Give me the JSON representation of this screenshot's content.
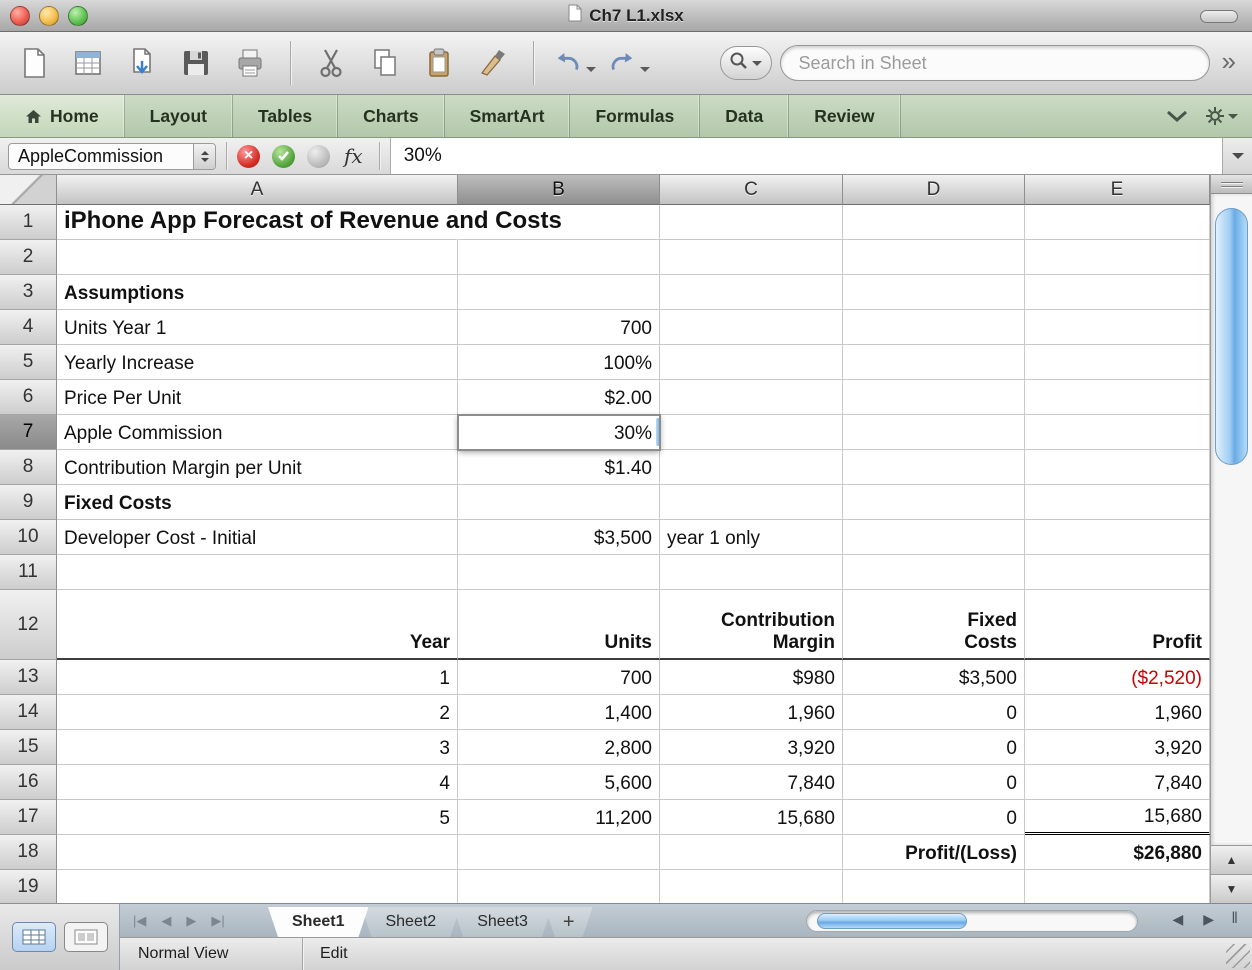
{
  "window": {
    "title": "Ch7 L1.xlsx"
  },
  "toolbar": {
    "groups": [
      [
        "new-document",
        "template-gallery",
        "import",
        "save",
        "print"
      ],
      [
        "cut",
        "copy",
        "paste",
        "format-painter"
      ],
      [
        "undo",
        "redo"
      ]
    ],
    "search_placeholder": "Search in Sheet",
    "overflow_label": "»"
  },
  "ribbon": {
    "tabs": [
      {
        "label": "Home",
        "icon": "home",
        "active": true
      },
      {
        "label": "Layout"
      },
      {
        "label": "Tables"
      },
      {
        "label": "Charts"
      },
      {
        "label": "SmartArt"
      },
      {
        "label": "Formulas"
      },
      {
        "label": "Data"
      },
      {
        "label": "Review"
      }
    ]
  },
  "formula_bar": {
    "name_box": "AppleCommission",
    "cancel_label": "×",
    "fx": "fx",
    "value": "30%"
  },
  "grid": {
    "column_headers": [
      "A",
      "B",
      "C",
      "D",
      "E"
    ],
    "selected_column": "B",
    "selected_row": 7,
    "rows": [
      {
        "n": 1,
        "cells": {
          "A": {
            "v": "iPhone App Forecast of Revenue and Costs",
            "bold": true,
            "size": "title",
            "spill": true
          }
        }
      },
      {
        "n": 2,
        "cells": {}
      },
      {
        "n": 3,
        "cells": {
          "A": {
            "v": "Assumptions",
            "bold": true
          }
        }
      },
      {
        "n": 4,
        "cells": {
          "A": {
            "v": "Units Year 1"
          },
          "B": {
            "v": "700",
            "align": "right"
          }
        }
      },
      {
        "n": 5,
        "cells": {
          "A": {
            "v": "Yearly Increase"
          },
          "B": {
            "v": "100%",
            "align": "right"
          }
        }
      },
      {
        "n": 6,
        "cells": {
          "A": {
            "v": "Price Per Unit"
          },
          "B": {
            "v": "$2.00",
            "align": "right"
          }
        }
      },
      {
        "n": 7,
        "cells": {
          "A": {
            "v": "Apple Commission"
          },
          "B": {
            "v": "30%",
            "align": "right",
            "selected": true
          }
        }
      },
      {
        "n": 8,
        "cells": {
          "A": {
            "v": "Contribution Margin per Unit"
          },
          "B": {
            "v": "$1.40",
            "align": "right"
          }
        }
      },
      {
        "n": 9,
        "cells": {
          "A": {
            "v": "Fixed  Costs",
            "bold": true
          }
        }
      },
      {
        "n": 10,
        "cells": {
          "A": {
            "v": "Developer Cost - Initial"
          },
          "B": {
            "v": "$3,500",
            "align": "right"
          },
          "C": {
            "v": "year 1 only"
          }
        }
      },
      {
        "n": 11,
        "cells": {}
      },
      {
        "n": 12,
        "tall": true,
        "border_bottom": true,
        "cells": {
          "A": {
            "v": "Year",
            "bold": true,
            "align": "right"
          },
          "B": {
            "v": "Units",
            "bold": true,
            "align": "right"
          },
          "C": {
            "v": "Contribution\nMargin",
            "bold": true,
            "align": "right"
          },
          "D": {
            "v": "Fixed\nCosts",
            "bold": true,
            "align": "right"
          },
          "E": {
            "v": "Profit",
            "bold": true,
            "align": "right"
          }
        }
      },
      {
        "n": 13,
        "cells": {
          "A": {
            "v": "1",
            "align": "right"
          },
          "B": {
            "v": "700",
            "align": "right"
          },
          "C": {
            "v": "$980",
            "align": "right"
          },
          "D": {
            "v": "$3,500",
            "align": "right"
          },
          "E": {
            "v": "($2,520)",
            "align": "right",
            "color": "negative"
          }
        }
      },
      {
        "n": 14,
        "cells": {
          "A": {
            "v": "2",
            "align": "right"
          },
          "B": {
            "v": "1,400",
            "align": "right"
          },
          "C": {
            "v": "1,960",
            "align": "right"
          },
          "D": {
            "v": "0",
            "align": "right"
          },
          "E": {
            "v": "1,960",
            "align": "right"
          }
        }
      },
      {
        "n": 15,
        "cells": {
          "A": {
            "v": "3",
            "align": "right"
          },
          "B": {
            "v": "2,800",
            "align": "right"
          },
          "C": {
            "v": "3,920",
            "align": "right"
          },
          "D": {
            "v": "0",
            "align": "right"
          },
          "E": {
            "v": "3,920",
            "align": "right"
          }
        }
      },
      {
        "n": 16,
        "cells": {
          "A": {
            "v": "4",
            "align": "right"
          },
          "B": {
            "v": "5,600",
            "align": "right"
          },
          "C": {
            "v": "7,840",
            "align": "right"
          },
          "D": {
            "v": "0",
            "align": "right"
          },
          "E": {
            "v": "7,840",
            "align": "right"
          }
        }
      },
      {
        "n": 17,
        "cells": {
          "A": {
            "v": "5",
            "align": "right"
          },
          "B": {
            "v": "11,200",
            "align": "right"
          },
          "C": {
            "v": "15,680",
            "align": "right"
          },
          "D": {
            "v": "0",
            "align": "right"
          },
          "E": {
            "v": "15,680",
            "align": "right",
            "double_underline": true
          }
        }
      },
      {
        "n": 18,
        "cells": {
          "D": {
            "v": "Profit/(Loss)",
            "bold": true,
            "align": "right"
          },
          "E": {
            "v": "$26,880",
            "bold": true,
            "align": "right"
          }
        }
      },
      {
        "n": 19,
        "partial": true,
        "cells": {}
      }
    ]
  },
  "sheet_bar": {
    "tabs": [
      {
        "label": "Sheet1",
        "active": true
      },
      {
        "label": "Sheet2"
      },
      {
        "label": "Sheet3"
      }
    ],
    "add_tab_label": "+",
    "nav_icons": [
      "first-sheet",
      "previous-sheet",
      "next-sheet",
      "last-sheet"
    ]
  },
  "status_bar": {
    "view_label": "Normal View",
    "mode_label": "Edit"
  },
  "colors": {
    "negative": "#cc0000",
    "scroll_thumb": "#69aae6",
    "ribbon_bg": "#bfd2b7"
  }
}
